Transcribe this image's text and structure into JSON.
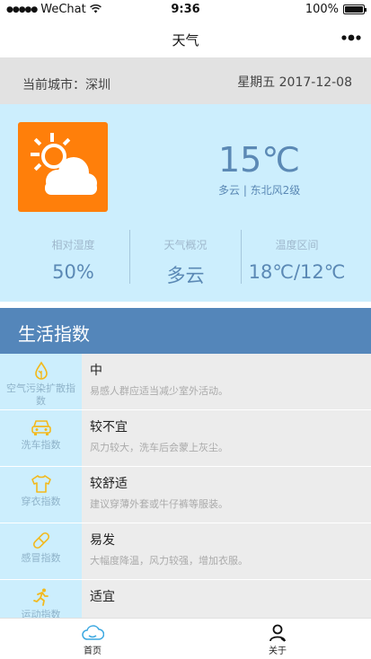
{
  "status_bar": {
    "carrier": "WeChat",
    "signal_icon": "signal-dots-icon",
    "wifi_icon": "wifi-icon",
    "time": "9:36",
    "battery": "100%",
    "battery_icon": "battery-icon"
  },
  "nav": {
    "title": "天气",
    "more_icon": "more-dots-icon"
  },
  "city_bar": {
    "city": "当前城市：深圳",
    "date": "星期五 2017-12-08"
  },
  "weather": {
    "icon": "partly-cloudy-icon",
    "icon_bg": "#ff7f0a",
    "temperature": "15℃",
    "description": "多云 | 东北风2级",
    "stats": [
      {
        "label": "相对湿度",
        "value": "50%"
      },
      {
        "label": "天气概况",
        "value": "多云"
      },
      {
        "label": "温度区间",
        "value": "18℃/12℃"
      }
    ]
  },
  "life_index": {
    "title": "生活指数",
    "items": [
      {
        "name": "空气污染扩散指数",
        "icon": "leaf-drop-icon",
        "level": "中",
        "desc": "易感人群应适当减少室外活动。"
      },
      {
        "name": "洗车指数",
        "icon": "car-icon",
        "level": "较不宜",
        "desc": "风力较大，洗车后会蒙上灰尘。"
      },
      {
        "name": "穿衣指数",
        "icon": "shirt-icon",
        "level": "较舒适",
        "desc": "建议穿薄外套或牛仔裤等服装。"
      },
      {
        "name": "感冒指数",
        "icon": "pill-icon",
        "level": "易发",
        "desc": "大幅度降温，风力较强，增加衣服。"
      },
      {
        "name": "运动指数",
        "icon": "runner-icon",
        "level": "适宜",
        "desc": ""
      }
    ]
  },
  "tab_bar": {
    "tabs": [
      {
        "label": "首页",
        "icon": "cloud-home-icon"
      },
      {
        "label": "关于",
        "icon": "person-icon"
      }
    ]
  },
  "colors": {
    "accent_blue": "#5486ba",
    "card_bg": "#cceefd",
    "icon_yellow": "#f3b91c"
  }
}
